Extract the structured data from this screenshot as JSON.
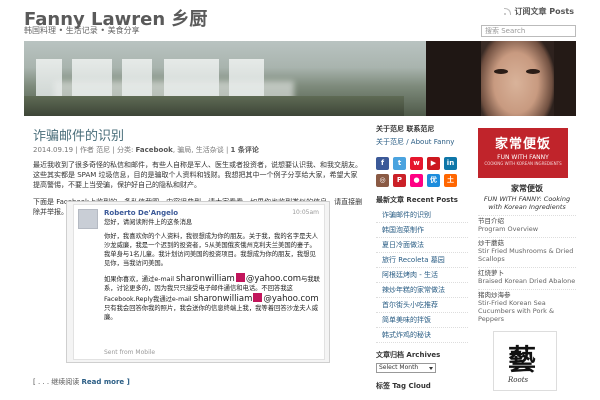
{
  "header": {
    "site_title": "Fanny Lawren 乡厨",
    "site_description": "韩国料理 • 生活记录 • 美食分享",
    "posts_feed_label": "订阅文章 Posts",
    "search_placeholder": "搜索 Search"
  },
  "post": {
    "title": "诈骗邮件的识别",
    "meta": {
      "date": "2014.09.19",
      "author": "作者 范尼",
      "category_prefix": "分类:",
      "category": "Facebook",
      "tags": "骗局, 生活杂谈",
      "comments": "1 条评论"
    },
    "paragraph_1": "最近我收到了很多奇怪的私信和邮件，有些人自称是军人、医生或者投资者，说想要认识我、和我交朋友。这些其实都是 SPAM 垃圾信息，目的是骗取个人资料和钱财。我想把其中一个例子分享给大家，希望大家提高警惕，不要上当受骗，保护好自己的隐私和财产。",
    "paragraph_2": "下面是 Facebook上收到的一条私信截图，内容很典型。请大家看看，如果你也收到类似的信息，请直接删除并举报。",
    "read_more_prefix": "[ . . . 继续阅读",
    "read_more_label": "Read more ]"
  },
  "message": {
    "sender": "Roberto De'Angelo",
    "time": "10:05am",
    "line_1": "您好，请阅读附件上的这条消息",
    "line_2": "你好，我喜欢你的个人资料，我很想成为你的朋友。关于我，我的名字是夫人沙龙威廉，我是一个迟到的投资者，5从美国俄亥俄州克利夫兰美国的妻子。我单身与1名儿童。我计划访问美国的投资项目。我想成为你的朋友，我想见见你，当我访问美国。",
    "line_3a": "如果你喜欢，通过e-mail",
    "email_user": "sharonwilliam",
    "email_domain": "@yahoo.com",
    "line_3b": "与我联系，讨论更多的，因为我只只接受电子邮件通信和电话。不回答我这Facebook.Reply我通过e-mail",
    "line_3c": "只有我会回答你我的照片，我会送你的信息终端上我，我等着回答沙龙夫人威廉。",
    "sent_from": "Sent from Mobile"
  },
  "sidebar": {
    "about_title": "关于范尼 联系范尼",
    "about_link": "关于范尼 / About Fanny",
    "social_icons": [
      {
        "name": "facebook-icon",
        "glyph": "f",
        "color": "#3b5998"
      },
      {
        "name": "twitter-icon",
        "glyph": "t",
        "color": "#4aa3df"
      },
      {
        "name": "weibo-icon",
        "glyph": "w",
        "color": "#e6162d"
      },
      {
        "name": "youtube-icon",
        "glyph": "▶",
        "color": "#cc181e"
      },
      {
        "name": "linkedin-icon",
        "glyph": "in",
        "color": "#0e76a8"
      },
      {
        "name": "instagram-icon",
        "glyph": "◎",
        "color": "#8a5a44"
      },
      {
        "name": "pinterest-icon",
        "glyph": "P",
        "color": "#cb2027"
      },
      {
        "name": "flickr-icon",
        "glyph": "●",
        "color": "#ff0084"
      },
      {
        "name": "youku-icon",
        "glyph": "优",
        "color": "#1d8cdc"
      },
      {
        "name": "tudou-icon",
        "glyph": "土",
        "color": "#ff6600"
      }
    ],
    "recent_title": "最新文章 Recent Posts",
    "recent_posts": [
      "诈骗邮件的识别",
      "韩国泡菜制作",
      "夏日冷面做法",
      "旅行 Recoleta 墓园",
      "阿根廷烤肉 - 生活",
      "辣炒年糕的家常做法",
      "首尔街头小吃推荐",
      "简单美味的拌饭",
      "韩式炸鸡的秘诀"
    ],
    "archives_title": "文章归档 Archives",
    "archives_select": "Select Month",
    "tag_title": "标签 Tag Cloud"
  },
  "book": {
    "cover_title": "家常便饭",
    "cover_sub": "FUN WITH FANNY",
    "cover_sub2": "COOKING WITH KOREAN INGREDIENTS",
    "title": "家常便饭",
    "description": "FUN WITH FANNY: Cooking with Korean Ingredients",
    "recipes": [
      {
        "cn": "节目介绍",
        "en": "Program Overview"
      },
      {
        "cn": "炒干蘑菇",
        "en": "Stir Fried Mushrooms & Dried Scallops"
      },
      {
        "cn": "红烧萝卜",
        "en": "Braised Korean Dried Abalone"
      },
      {
        "cn": "猪肉炒海参",
        "en": "Stir-Fried Korean Sea Cucumbers with Pork & Peppers"
      }
    ],
    "book2_glyph": "藝",
    "book2_label": "Roots"
  }
}
